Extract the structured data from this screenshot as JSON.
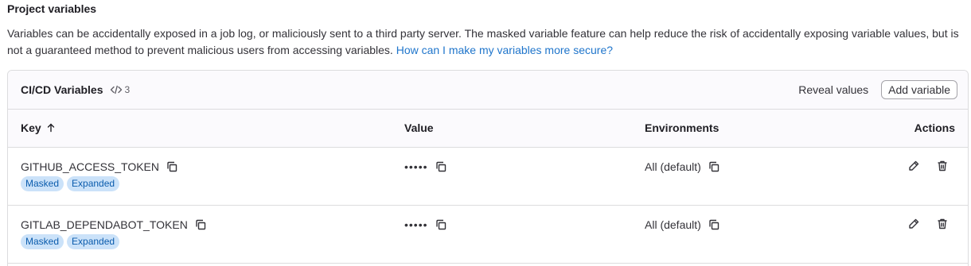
{
  "section": {
    "title": "Project variables",
    "description": "Variables can be accidentally exposed in a job log, or maliciously sent to a third party server. The masked variable feature can help reduce the risk of accidentally exposing variable values, but is not a guaranteed method to prevent malicious users from accessing variables.",
    "help_link": "How can I make my variables more secure?"
  },
  "card": {
    "title": "CI/CD Variables",
    "count": "3",
    "count_icon": "code-icon",
    "reveal_label": "Reveal values",
    "add_label": "Add variable"
  },
  "table": {
    "headers": {
      "key": "Key",
      "value": "Value",
      "environments": "Environments",
      "actions": "Actions"
    },
    "sort_icon": "arrow-up-icon",
    "rows": [
      {
        "key": "GITHUB_ACCESS_TOKEN",
        "badges": [
          "Masked",
          "Expanded"
        ],
        "value": "•••••",
        "environment": "All (default)"
      },
      {
        "key": "GITLAB_DEPENDABOT_TOKEN",
        "badges": [
          "Masked",
          "Expanded"
        ],
        "value": "•••••",
        "environment": "All (default)"
      }
    ]
  },
  "colors": {
    "link": "#1f75cb",
    "badge_bg": "#cbe2f9",
    "badge_text": "#0b5cad",
    "border": "#dcdcde"
  }
}
